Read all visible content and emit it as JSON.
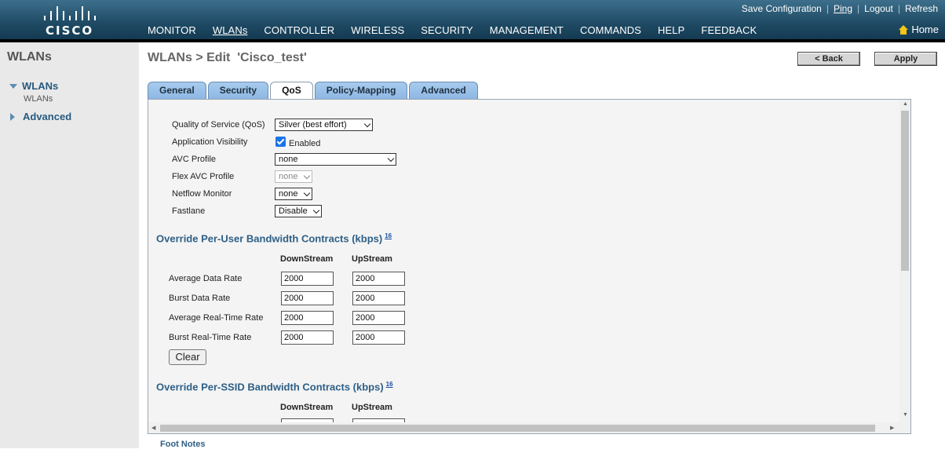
{
  "header": {
    "logo_text": "CISCO",
    "top_links": [
      "Save Configuration",
      "Ping",
      "Logout",
      "Refresh"
    ],
    "nav": [
      "MONITOR",
      "WLANs",
      "CONTROLLER",
      "WIRELESS",
      "SECURITY",
      "MANAGEMENT",
      "COMMANDS",
      "HELP",
      "FEEDBACK"
    ],
    "active_nav": "WLANs",
    "home_label": "Home"
  },
  "sidebar": {
    "title": "WLANs",
    "items": [
      {
        "label": "WLANs",
        "expanded": true,
        "sub": [
          "WLANs"
        ]
      },
      {
        "label": "Advanced",
        "expanded": false
      }
    ]
  },
  "page": {
    "title": "WLANs > Edit  'Cisco_test'",
    "back_label": "< Back",
    "apply_label": "Apply"
  },
  "tabs": [
    "General",
    "Security",
    "QoS",
    "Policy-Mapping",
    "Advanced"
  ],
  "active_tab": "QoS",
  "qos": {
    "fields": [
      {
        "label": "Quality of Service (QoS)",
        "value": "Silver (best effort)"
      },
      {
        "label": "Application Visibility",
        "value": "Enabled",
        "checked": true
      },
      {
        "label": "AVC Profile",
        "value": "none"
      },
      {
        "label": "Flex AVC Profile",
        "value": "none",
        "disabled": true
      },
      {
        "label": "Netflow Monitor",
        "value": "none"
      },
      {
        "label": "Fastlane",
        "value": "Disable"
      }
    ]
  },
  "per_user": {
    "title": "Override Per-User Bandwidth Contracts (kbps)",
    "footnote": "16",
    "col_down": "DownStream",
    "col_up": "UpStream",
    "rows": [
      {
        "label": "Average Data Rate",
        "down": "2000",
        "up": "2000"
      },
      {
        "label": "Burst Data Rate",
        "down": "2000",
        "up": "2000"
      },
      {
        "label": "Average Real-Time Rate",
        "down": "2000",
        "up": "2000"
      },
      {
        "label": "Burst Real-Time Rate",
        "down": "2000",
        "up": "2000"
      }
    ],
    "clear_label": "Clear"
  },
  "per_ssid": {
    "title": "Override Per-SSID Bandwidth Contracts (kbps)",
    "footnote": "16",
    "col_down": "DownStream",
    "col_up": "UpStream"
  },
  "footer": {
    "foot_notes": "Foot Notes"
  },
  "colors": {
    "accent_header": "#1f4a64",
    "tab_blue": "#9ec3eb",
    "section_title": "#2d5f86"
  }
}
